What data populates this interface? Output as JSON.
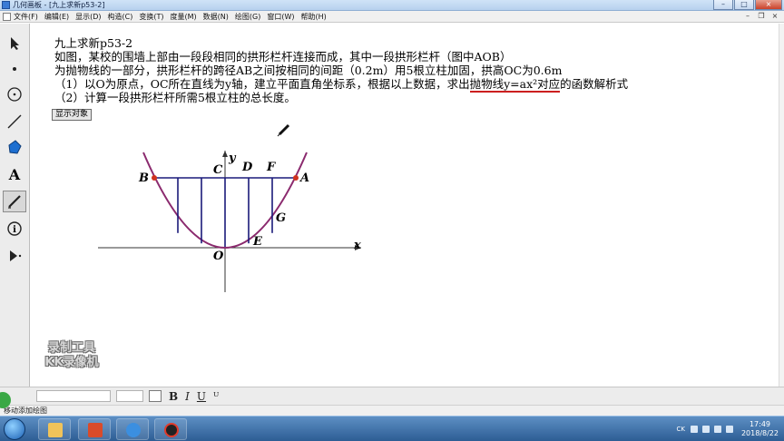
{
  "window": {
    "title": "几何画板 - [九上求新p53-2]"
  },
  "menu": [
    "文件(F)",
    "编辑(E)",
    "显示(D)",
    "构造(C)",
    "变换(T)",
    "度量(M)",
    "数据(N)",
    "绘图(G)",
    "窗口(W)",
    "帮助(H)"
  ],
  "problem": {
    "line1": "九上求新p53-2",
    "line2": "如图，某校的围墙上部由一段段相同的拱形栏杆连接而成，其中一段拱形栏杆（图中AOB）",
    "line3": "为抛物线的一部分，拱形栏杆的跨径AB之间按相同的间距（0.2m）用5根立柱加固，拱高OC为0.6m",
    "line4_pre": "（1）以O为原点，OC所在直线为y轴，建立平面直角坐标系，根据以上数据，求出",
    "line4_hl": "抛物线y=ax²对应",
    "line4_post": "的函数解析式",
    "line5": "（2）计算一段拱形栏杆所需5根立柱的总长度。"
  },
  "show_button": "显示对象",
  "graph": {
    "labels": {
      "B": "B",
      "C": "C",
      "D": "D",
      "F": "F",
      "A": "A",
      "G": "G",
      "E": "E",
      "O": "O",
      "x": "x",
      "y": "y"
    }
  },
  "format_bar": {
    "bold": "B",
    "italic": "I",
    "underline": "U",
    "extra": "ᵁ"
  },
  "status": "移动添加绘图",
  "watermark": {
    "line1": "录制工具",
    "line2": "KK录像机"
  },
  "tray": {
    "lang": "CK"
  },
  "clock": {
    "time": "17:49",
    "date": "2018/8/22"
  },
  "colors": {
    "curve": "#8b2a6e",
    "posts": "#1a1a7a",
    "points": "#d0321e",
    "highlight": "#cc1f1f"
  }
}
